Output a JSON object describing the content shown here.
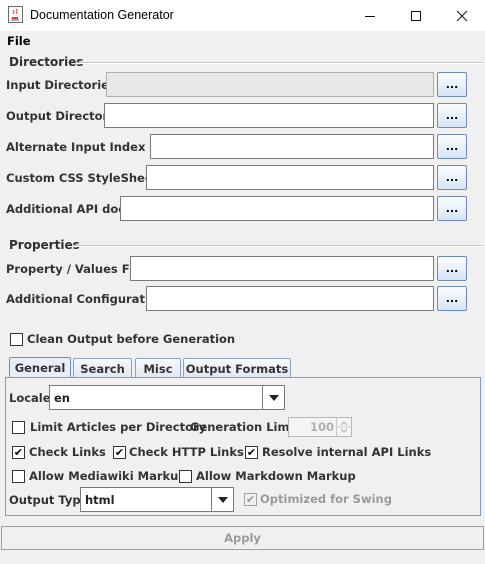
{
  "window": {
    "title": "Documentation Generator",
    "icon": "java-cup-icon"
  },
  "menu": {
    "file": "File"
  },
  "directories": {
    "title": "Directories",
    "input_dirs_label": "Input Directories",
    "output_dir_label": "Output Directory",
    "alt_index_label": "Alternate Input Index File",
    "custom_css_label": "Custom CSS StyleSheet",
    "additional_api_label": "Additional API docs",
    "browse_label": "..."
  },
  "properties": {
    "title": "Properties",
    "prop_file_label": "Property / Values File",
    "additional_config_label": "Additional Configuration",
    "browse_label": "..."
  },
  "clean_output": {
    "label": "Clean Output before Generation",
    "checked": false
  },
  "tabs": [
    "General",
    "Search",
    "Misc",
    "Output Formats"
  ],
  "general": {
    "locale_label": "Locale",
    "locale_value": "en",
    "limit_articles_label": "Limit Articles per Directory",
    "limit_articles_checked": false,
    "generation_limit_label": "Generation Limit",
    "generation_limit_value": "100",
    "check_links_label": "Check Links",
    "check_links_checked": true,
    "check_http_label": "Check HTTP Links",
    "check_http_checked": true,
    "resolve_api_label": "Resolve internal API Links",
    "resolve_api_checked": true,
    "mediawiki_label": "Allow Mediawiki Markup",
    "mediawiki_checked": false,
    "markdown_label": "Allow Markdown Markup",
    "markdown_checked": false,
    "output_type_label": "Output Type",
    "output_type_value": "html",
    "optimized_label": "Optimized for Swing",
    "optimized_checked": true
  },
  "apply_label": "Apply",
  "colors": {
    "tab_border": "#7f9dcb",
    "disabled_text": "#9a9a9a",
    "title_bar": "#ffffff"
  }
}
